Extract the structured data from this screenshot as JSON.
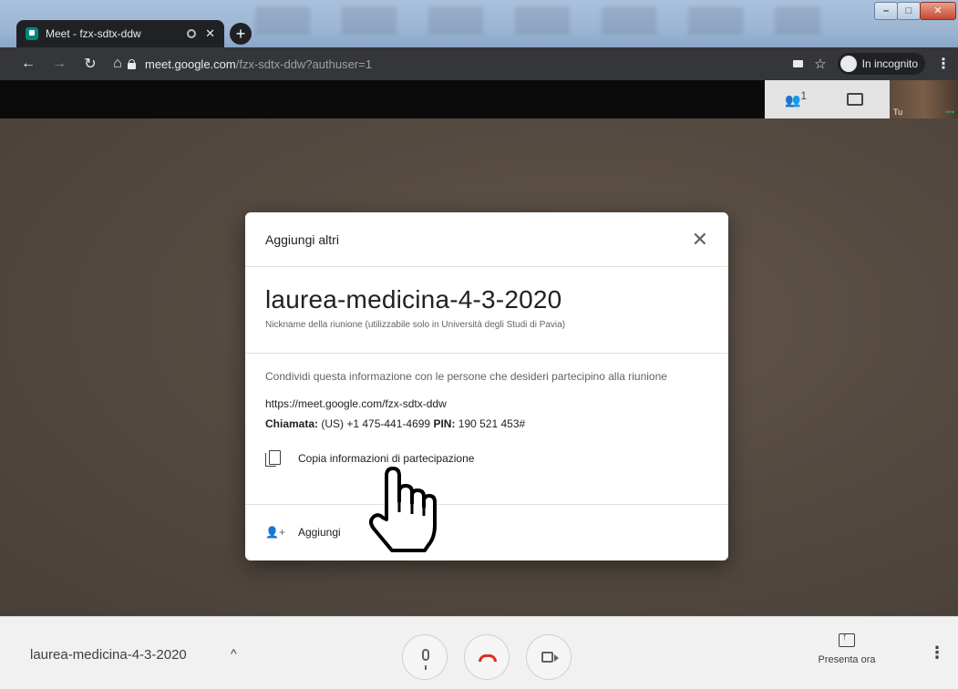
{
  "browser": {
    "tab_title": "Meet - fzx-sdtx-ddw",
    "new_tab_label": "+",
    "url_host": "meet.google.com",
    "url_path": "/fzx-sdtx-ddw?authuser=1",
    "incognito_label": "In incognito"
  },
  "meet": {
    "self_label": "Tu",
    "people_count": "1"
  },
  "dialog": {
    "title": "Aggiungi altri",
    "meeting_nickname": "laurea-medicina-4-3-2020",
    "nickname_note": "Nickname della riunione (utilizzabile solo in Università degli Studi di Pavia)",
    "share_text": "Condividi questa informazione con le persone che desideri partecipino alla riunione",
    "join_url": "https://meet.google.com/fzx-sdtx-ddw",
    "dial_label": "Chiamata:",
    "dial_number": " (US) +1 475-441-4699 ",
    "pin_label": "PIN:",
    "pin_value": " 190 521 453#",
    "copy_label": "Copia informazioni di partecipazione",
    "add_label": "Aggiungi"
  },
  "bottom_bar": {
    "meeting_name": "laurea-medicina-4-3-2020",
    "present_label": "Presenta ora"
  },
  "icons": {
    "hangup_color": "#d93025",
    "favicon_color": "#00897b"
  }
}
